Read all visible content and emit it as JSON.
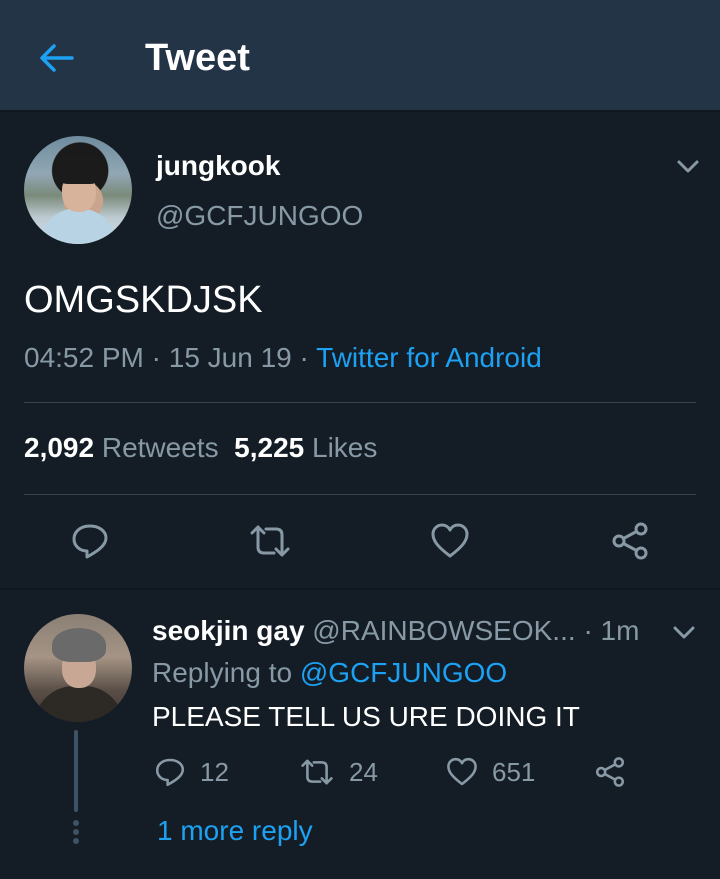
{
  "header": {
    "title": "Tweet",
    "back_icon": "back-arrow-icon",
    "accent": "#1da1f2"
  },
  "tweet": {
    "user": {
      "name": "jungkook",
      "handle": "@GCFJUNGOO"
    },
    "text": "OMGSKDJSK",
    "time": "04:52 PM",
    "date_sep": " · ",
    "date": "15 Jun 19",
    "source_sep": " · ",
    "source": "Twitter for Android",
    "retweets_count": "2,092",
    "retweets_label": "Retweets",
    "likes_count": "5,225",
    "likes_label": "Likes",
    "actions": [
      "reply-icon",
      "retweet-icon",
      "like-icon",
      "share-icon"
    ]
  },
  "reply": {
    "user": {
      "name": "seokjin gay",
      "handle": "@RAINBOWSEOK...",
      "time": "· 1m"
    },
    "replying_prefix": "Replying to ",
    "replying_to": "@GCFJUNGOO",
    "text": "PLEASE TELL US URE DOING IT",
    "reply_count": "12",
    "retweet_count": "24",
    "like_count": "651",
    "more_replies": "1 more reply"
  },
  "colors": {
    "background": "#141d26",
    "header": "#243447",
    "muted": "#8899a6",
    "link": "#1da1f2"
  }
}
